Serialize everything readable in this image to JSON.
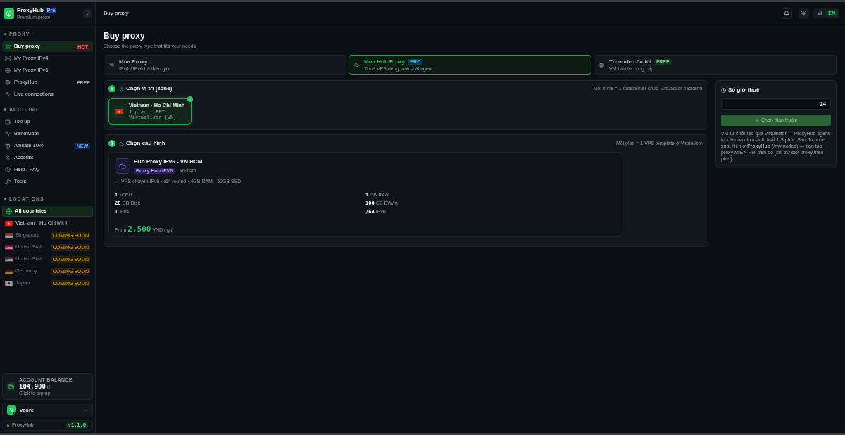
{
  "brand": {
    "name": "ProxyHub",
    "badge": "Pro",
    "tagline": "Premium proxy"
  },
  "sidebar": {
    "sections": [
      {
        "title": "PROXY",
        "items": [
          {
            "label": "Buy proxy",
            "selected": true,
            "badge": {
              "text": "HOT",
              "kind": "hot"
            }
          },
          {
            "label": "My Proxy IPv4",
            "selected": false
          },
          {
            "label": "My Proxy IPv6",
            "selected": false
          },
          {
            "label": "ProxyHub",
            "selected": false,
            "badge": {
              "text": "FREE",
              "kind": "plain"
            }
          },
          {
            "label": "Live connections",
            "selected": false
          }
        ]
      },
      {
        "title": "ACCOUNT",
        "items": [
          {
            "label": "Top up",
            "selected": false
          },
          {
            "label": "Bandwidth",
            "selected": false
          },
          {
            "label": "Affiliate 10%",
            "selected": false,
            "badge": {
              "text": "NEW",
              "kind": "new"
            }
          },
          {
            "label": "Account",
            "selected": false
          },
          {
            "label": "Help / FAQ",
            "selected": false
          },
          {
            "label": "Tools",
            "selected": false
          }
        ]
      }
    ]
  },
  "locations": {
    "title": "LOCATIONS",
    "items": [
      {
        "label": "All countries",
        "selected": true,
        "disabled": false
      },
      {
        "label": "Vietnam · Ho Chi Minh",
        "selected": false,
        "disabled": false
      },
      {
        "label": "Singapore",
        "selected": false,
        "disabled": true,
        "badge": "COMING SOON"
      },
      {
        "label": "United Stat...",
        "selected": false,
        "disabled": true,
        "badge": "COMING SOON"
      },
      {
        "label": "United Stat...",
        "selected": false,
        "disabled": true,
        "badge": "COMING SOON"
      },
      {
        "label": "Germany",
        "selected": false,
        "disabled": true,
        "badge": "COMING SOON"
      },
      {
        "label": "Japan",
        "selected": false,
        "disabled": true,
        "badge": "COMING SOON"
      }
    ]
  },
  "balance": {
    "label": "ACCOUNT BALANCE",
    "amount": "104,900",
    "currency": "đ",
    "hint": "Click to top up"
  },
  "user": {
    "initial": "V",
    "name": "vcore"
  },
  "footer": {
    "name": "ProxyHub",
    "version": "v1.1.0"
  },
  "header": {
    "title": "Buy proxy",
    "languages": [
      {
        "label": "VI",
        "selected": false
      },
      {
        "label": "EN",
        "selected": true
      }
    ]
  },
  "page": {
    "title": "Buy proxy",
    "subtitle": "Choose the proxy type that fits your needs"
  },
  "types": [
    {
      "title": "Mua Proxy",
      "subtitle": "IPv4 / IPv6 trả theo giờ",
      "selected": false
    },
    {
      "title": "Mua Hub Proxy",
      "badge": {
        "text": "PRO",
        "kind": "pro"
      },
      "subtitle": "Thuê VPS riêng, auto-cài agent",
      "selected": true
    },
    {
      "title": "Từ node của tôi",
      "badge": {
        "text": "FREE",
        "kind": "free"
      },
      "subtitle": "VM bạn tự cung cấp",
      "selected": false
    }
  ],
  "zone_step": {
    "number": "1",
    "title": "Chọn vị trí (zone)",
    "note": "Mỗi zone = 1 datacenter chứa Virtualizor backend.",
    "zones": [
      {
        "name": "Vietnam · Ho Chi Minh",
        "detail": "1 plan · FPT Virtualizor (VN)",
        "selected": true
      }
    ]
  },
  "plan_step": {
    "number": "2",
    "title": "Chọn cấu hình",
    "note": "Mỗi plan = 1 VPS template ở Virtualizor.",
    "plans": [
      {
        "name": "Hub Proxy IPv6 - VN HCM",
        "tag": "Proxy Hub IPV6",
        "code": "· vn-hcm",
        "feature": "VPS chuyên IPv6 · /64 routed · 4GB RAM · 50GB SSD",
        "specs": [
          {
            "value": "1",
            "unit": "vCPU"
          },
          {
            "value": "1",
            "unit": "GB RAM"
          },
          {
            "value": "20",
            "unit": "GB Disk"
          },
          {
            "value": "100",
            "unit": "GB BW/m"
          },
          {
            "value": "1",
            "unit": "IPv4"
          },
          {
            "value": "/64",
            "unit": "IPv6"
          }
        ],
        "price_prefix": "From",
        "price": "2,500",
        "price_suffix": "VND / giờ",
        "selected": false
      }
    ]
  },
  "rental": {
    "title": "Số giờ thuê",
    "hours": "24",
    "button": {
      "label": "Chọn plan trước",
      "disabled": true
    },
    "note": "VM tự khởi tạo qua Virtualizor → ProxyHub agent tự cài qua cloud-init. Mất 1-3 phút. Sau đó node xuất hiện ở **ProxyHub** (/my-nodes) — bạn tạo proxy MIỄN PHÍ trên đó (chỉ trừ slot proxy theo plan)."
  }
}
